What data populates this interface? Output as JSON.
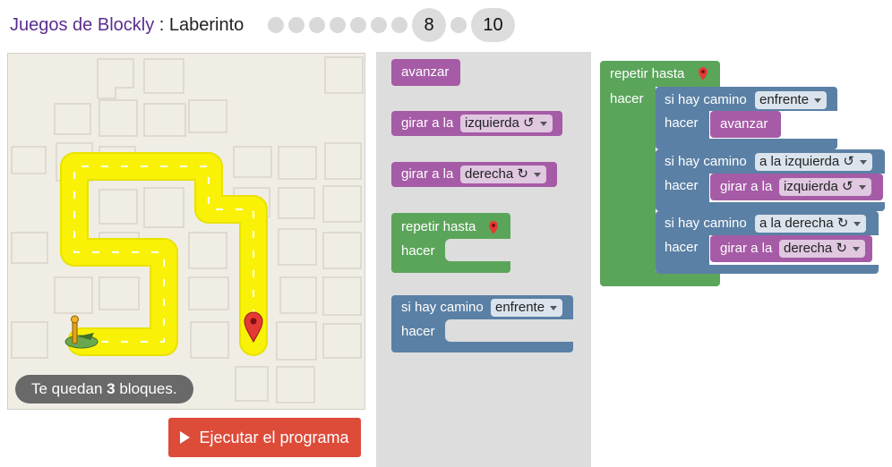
{
  "header": {
    "app_name": "Juegos de Blockly",
    "separator": " : ",
    "game_name": "Laberinto",
    "levels": {
      "current": "8",
      "last": "10"
    }
  },
  "maze": {
    "remaining_prefix": "Te quedan ",
    "remaining_count": "3",
    "remaining_suffix": " bloques."
  },
  "run_button": {
    "label": "Ejecutar el programa"
  },
  "toolbox": {
    "avanzar": "avanzar",
    "girar_izq_label": "girar a la",
    "girar_izq_value": "izquierda ↺",
    "girar_der_label": "girar a la",
    "girar_der_value": "derecha ↻",
    "repetir_label": "repetir hasta",
    "repetir_do": "hacer",
    "si_label": "si hay camino",
    "si_value": "enfrente",
    "si_do": "hacer"
  },
  "workspace": {
    "repetir_label": "repetir hasta",
    "repetir_do": "hacer",
    "if1": {
      "label": "si hay camino",
      "value": "enfrente",
      "do": "hacer",
      "action": "avanzar"
    },
    "if2": {
      "label": "si hay camino",
      "value": "a la izquierda ↺",
      "do": "hacer",
      "action_label": "girar a la",
      "action_value": "izquierda ↺"
    },
    "if3": {
      "label": "si hay camino",
      "value": "a la derecha ↻",
      "do": "hacer",
      "action_label": "girar a la",
      "action_value": "derecha ↻"
    }
  },
  "colors": {
    "purple": "#a55ba6",
    "green": "#5ba55b",
    "blue": "#5b80a5",
    "run": "#dd4b39",
    "path": "#f9f206"
  }
}
